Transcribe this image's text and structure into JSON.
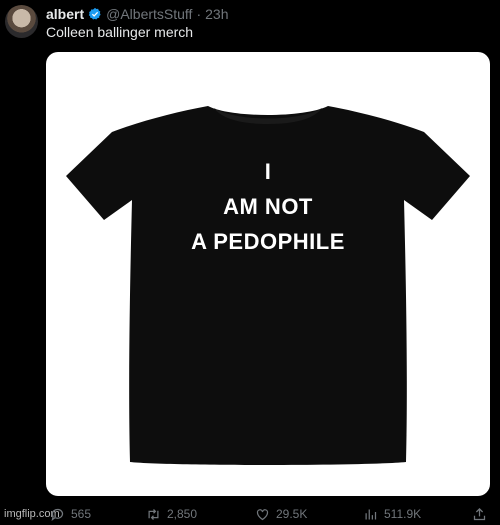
{
  "tweet": {
    "name": "albert",
    "handle": "@AlbertsStuff",
    "dot": "·",
    "time": "23h",
    "text": "Colleen ballinger merch"
  },
  "shirt": {
    "line1": "I",
    "line2": "AM NOT",
    "line3": "A PEDOPHILE"
  },
  "actions": {
    "replies": "565",
    "retweets": "2,850",
    "likes": "29.5K",
    "views": "511.9K"
  },
  "watermark": "imgflip.com",
  "colors": {
    "background": "#000000",
    "text_primary": "#e7e9ea",
    "text_secondary": "#71767b",
    "verified": "#1d9bf0",
    "shirt": "#0d0d0d"
  },
  "icons": [
    "verified-badge-icon",
    "reply-icon",
    "retweet-icon",
    "like-icon",
    "views-icon",
    "share-icon"
  ]
}
